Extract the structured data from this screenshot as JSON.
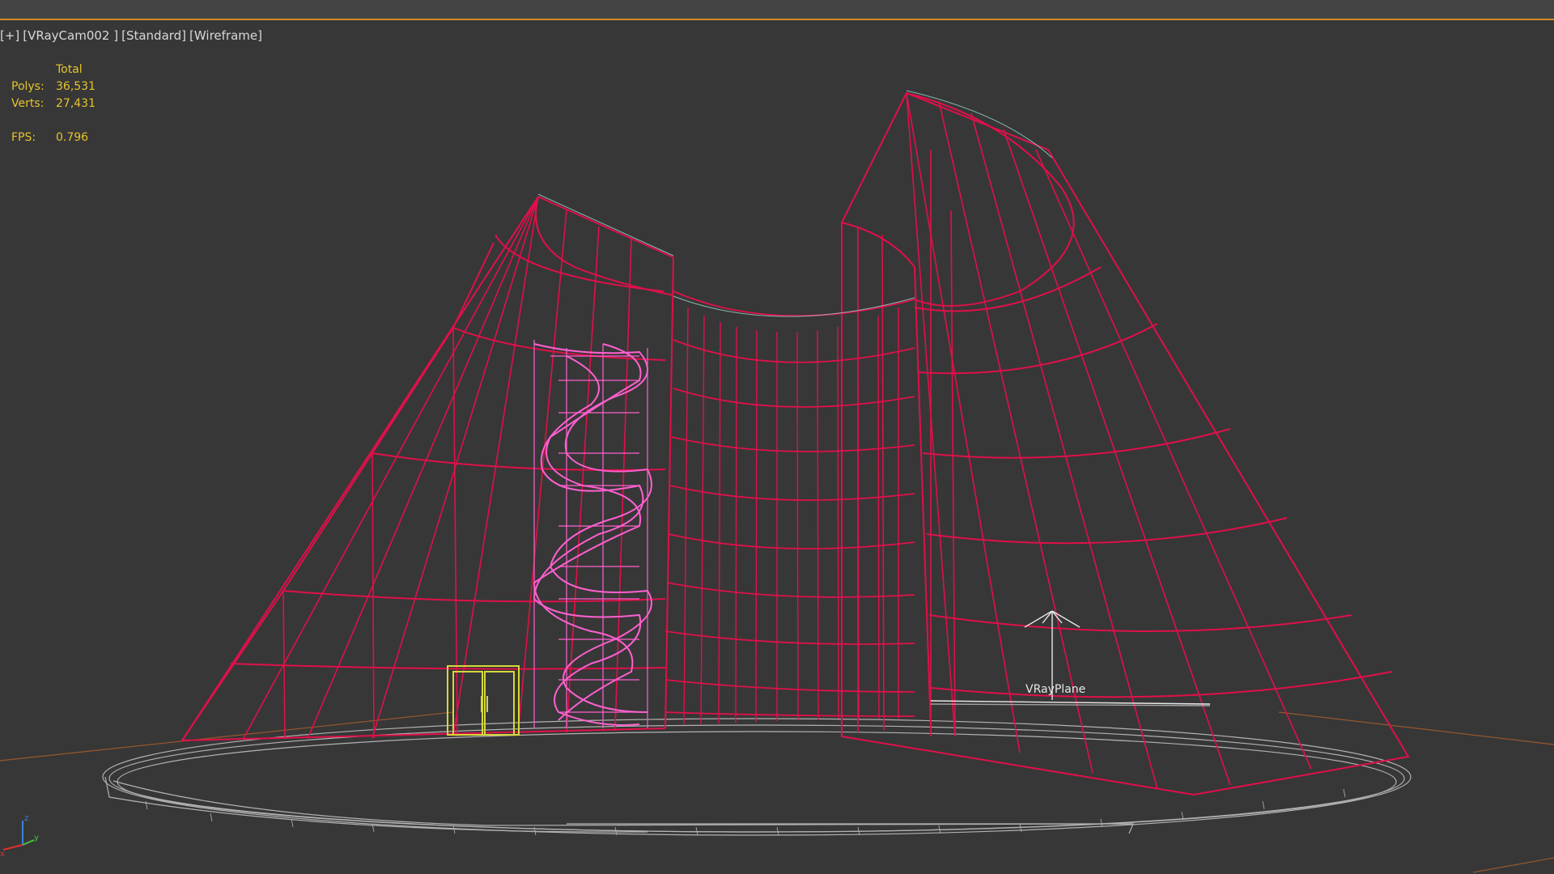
{
  "viewport": {
    "label": {
      "plus": "[+]",
      "camera": "[VRayCam002 ]",
      "shading_standard": "[Standard]",
      "shading_mode": "[Wireframe]"
    },
    "stats": {
      "header": "Total",
      "polys_label": "Polys:",
      "polys_value": "36,531",
      "verts_label": "Verts:",
      "verts_value": "27,431",
      "fps_label": "FPS:",
      "fps_value": "0.796"
    },
    "object_label": "VRayPlane",
    "axis_gizmo": {
      "x": "x",
      "y": "y",
      "z": "z"
    }
  },
  "colors": {
    "background": "#373737",
    "stats_text": "#e5c32c",
    "wire_main": "#e0104a",
    "wire_stairs": "#ff60d0",
    "wire_door": "#d4d83a",
    "wire_base": "#c8c8c8",
    "active_border": "#d28a2a"
  },
  "icons": {
    "axis_gizmo": "xyz-axis-gizmo-icon",
    "vray_plane": "vray-plane-arrow-icon"
  }
}
